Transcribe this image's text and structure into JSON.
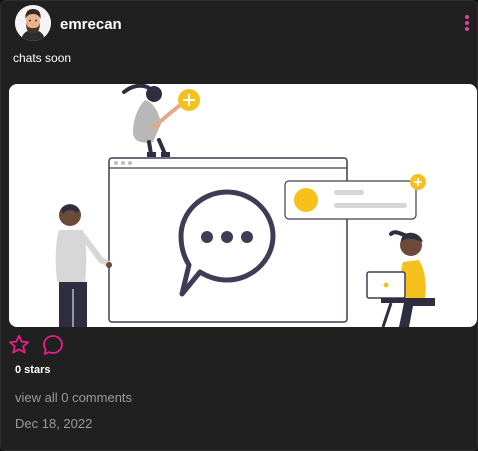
{
  "post": {
    "username": "emrecan",
    "caption": "chats soon",
    "stars_text": "0 stars",
    "comments_link": "view all 0 comments",
    "date": "Dec 18, 2022"
  },
  "icons": {
    "avatar": "user-avatar",
    "more": "more-vertical-icon",
    "star": "star-outline-icon",
    "comment": "comment-bubble-icon"
  },
  "colors": {
    "accent": "#e91e8c",
    "more_dots": "#e040a0",
    "illustration_yellow": "#f6c01d",
    "illustration_dark": "#3f3d56",
    "background": "#202020",
    "muted_text": "#9a9a9a"
  }
}
